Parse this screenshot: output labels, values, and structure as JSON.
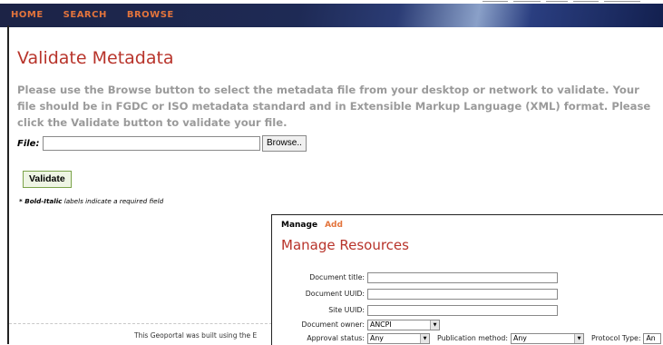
{
  "nav": {
    "home": "HOME",
    "search": "SEARCH",
    "browse": "BROWSE"
  },
  "validate": {
    "title": "Validate Metadata",
    "instructions": "Please use the Browse button to select the metadata file from your desktop or network to validate. Your file should be in FGDC or ISO metadata standard and in Extensible Markup Language (XML) format. Please click the Validate button to validate your file.",
    "file_label": "File:",
    "file_value": "",
    "browse_label": "Browse..",
    "validate_label": "Validate",
    "required_bold": "* Bold-Italic",
    "required_rest": " labels indicate a required field"
  },
  "footer": {
    "text": "This Geoportal was built using the E"
  },
  "manage": {
    "tab_manage": "Manage",
    "tab_add": "Add",
    "title": "Manage Resources",
    "document_title_label": "Document title:",
    "document_uuid_label": "Document UUID:",
    "site_uuid_label": "Site UUID:",
    "document_owner_label": "Document owner:",
    "document_owner_value": "ANCPI",
    "approval_status_label": "Approval status:",
    "approval_status_value": "Any",
    "publication_method_label": "Publication method:",
    "publication_method_value": "Any",
    "protocol_type_label": "Protocol Type:",
    "protocol_type_value": "An"
  },
  "colors": {
    "accent": "#e3743c",
    "title_red": "#b8342b",
    "navy": "#1c2346",
    "validate_green": "#7ba34a"
  }
}
